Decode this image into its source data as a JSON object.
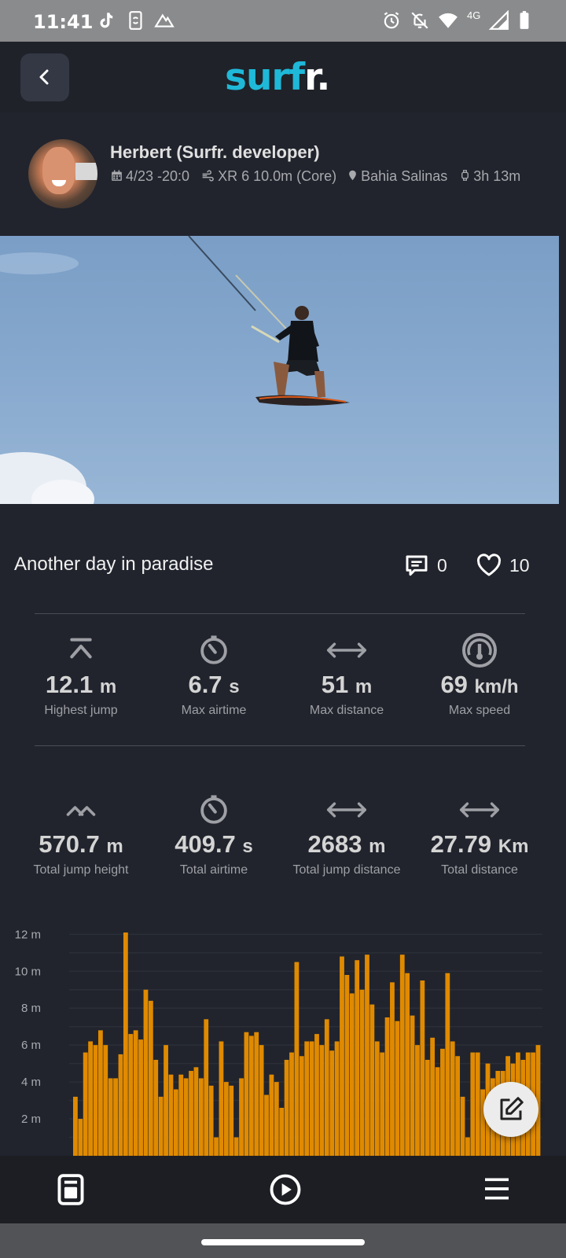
{
  "status_bar": {
    "time": "11:41",
    "network": "4G"
  },
  "header": {
    "logo_part1": "surf",
    "logo_part2": "r."
  },
  "profile": {
    "name": "Herbert (Surfr. developer)",
    "date": "4/23 -20:0",
    "gear": "XR 6 10.0m (Core)",
    "location": "Bahia Salinas",
    "duration": "3h 13m"
  },
  "post": {
    "caption": "Another day in paradise",
    "comments": "0",
    "likes": "10"
  },
  "stats_top": [
    {
      "value": "12.1",
      "unit": "m",
      "label": "Highest jump",
      "icon": "jump-up-icon"
    },
    {
      "value": "6.7",
      "unit": "s",
      "label": "Max airtime",
      "icon": "timer-icon"
    },
    {
      "value": "51",
      "unit": "m",
      "label": "Max distance",
      "icon": "distance-arrows-icon"
    },
    {
      "value": "69",
      "unit": "km/h",
      "label": "Max speed",
      "icon": "speedometer-icon"
    }
  ],
  "stats_bottom": [
    {
      "value": "570.7",
      "unit": "m",
      "label": "Total jump height",
      "icon": "double-chevron-up-icon"
    },
    {
      "value": "409.7",
      "unit": "s",
      "label": "Total airtime",
      "icon": "timer-icon"
    },
    {
      "value": "2683",
      "unit": "m",
      "label": "Total jump distance",
      "icon": "distance-arrows-icon"
    },
    {
      "value": "27.79",
      "unit": "Km",
      "label": "Total distance",
      "icon": "distance-arrows-icon"
    }
  ],
  "colors": {
    "accent": "#1fb8d8",
    "bar": "#e08a00",
    "background": "#21242d"
  },
  "chart_data": {
    "type": "bar",
    "title": "",
    "ylabel": "",
    "ytick_labels": [
      "2 m",
      "4 m",
      "6 m",
      "8 m",
      "10 m",
      "12 m"
    ],
    "ylim": [
      0,
      12.1
    ],
    "values": [
      3.2,
      2.0,
      5.6,
      6.2,
      6.0,
      6.8,
      6.0,
      4.2,
      4.2,
      5.5,
      12.1,
      6.6,
      6.8,
      6.3,
      9.0,
      8.4,
      5.2,
      3.2,
      6.0,
      4.4,
      3.6,
      4.4,
      4.2,
      4.6,
      4.8,
      4.2,
      7.4,
      3.8,
      1.0,
      6.2,
      4.0,
      3.8,
      1.0,
      4.2,
      6.7,
      6.5,
      6.7,
      6.0,
      3.3,
      4.4,
      4.0,
      2.6,
      5.2,
      5.6,
      10.5,
      5.4,
      6.2,
      6.2,
      6.6,
      6.0,
      7.4,
      5.7,
      6.2,
      10.8,
      9.8,
      8.8,
      10.6,
      9.0,
      10.9,
      8.2,
      6.2,
      5.6,
      7.5,
      9.4,
      7.3,
      10.9,
      9.9,
      7.6,
      6.0,
      9.5,
      5.2,
      6.4,
      4.8,
      5.8,
      9.9,
      6.2,
      5.4,
      3.2,
      1.0,
      5.6,
      5.6,
      3.6,
      5.0,
      4.2,
      4.6,
      4.6,
      5.4,
      5.0,
      5.6,
      5.2,
      5.6,
      5.6,
      6.0
    ]
  }
}
